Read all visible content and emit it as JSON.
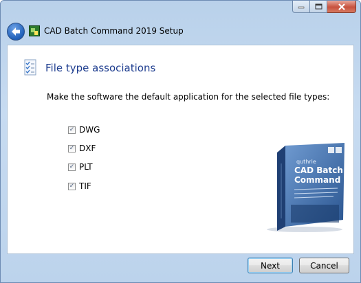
{
  "window": {
    "title": "CAD Batch Command 2019 Setup",
    "icons": {
      "minimize": "minimize-icon",
      "maximize": "maximize-icon",
      "close": "close-icon",
      "back": "back-arrow-icon",
      "app": "cad-batch-app-icon"
    }
  },
  "page": {
    "heading": "File type associations",
    "instruction": "Make the software the default application for the selected file types:"
  },
  "file_types": [
    {
      "label": "DWG",
      "checked": true
    },
    {
      "label": "DXF",
      "checked": true
    },
    {
      "label": "PLT",
      "checked": true
    },
    {
      "label": "TIF",
      "checked": true
    }
  ],
  "boxart": {
    "brand": "quthrie",
    "product_line1": "CAD Batch",
    "product_line2": "Command"
  },
  "buttons": {
    "next": "Next",
    "cancel": "Cancel"
  },
  "colors": {
    "heading": "#1e3d8f",
    "frame": "#bcd3ec",
    "box_blue": "#2f5f9e"
  }
}
